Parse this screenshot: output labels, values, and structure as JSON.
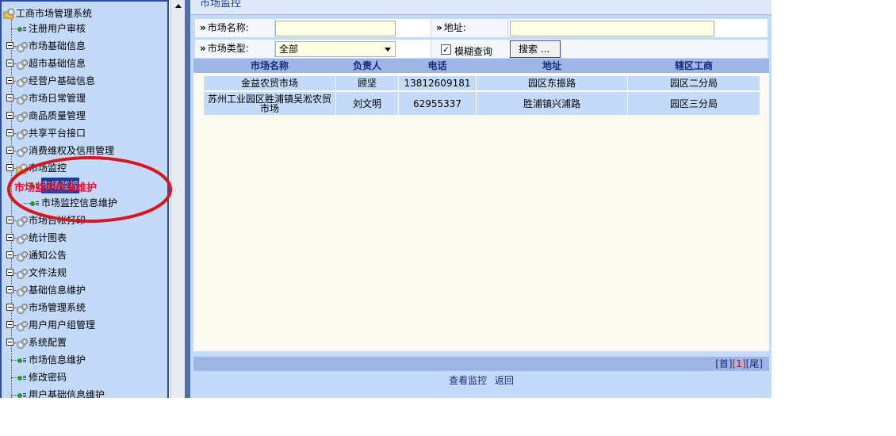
{
  "tree": {
    "root": "工商市场管理系统",
    "items": [
      {
        "label": "注册用户审核",
        "type": "leaf"
      },
      {
        "label": "市场基础信息",
        "type": "folder"
      },
      {
        "label": "超市基础信息",
        "type": "folder"
      },
      {
        "label": "经营户基础信息",
        "type": "folder"
      },
      {
        "label": "市场日常管理",
        "type": "folder"
      },
      {
        "label": "商品质量管理",
        "type": "folder"
      },
      {
        "label": "共享平台接口",
        "type": "folder"
      },
      {
        "label": "消费维权及信用管理",
        "type": "folder"
      },
      {
        "label": "市场监控",
        "type": "open-folder"
      },
      {
        "label": "市场监控",
        "type": "child"
      },
      {
        "label": "市场监控信息维护",
        "type": "child"
      },
      {
        "label": "市场台帐打印",
        "type": "folder"
      },
      {
        "label": "统计图表",
        "type": "folder"
      },
      {
        "label": "通知公告",
        "type": "folder"
      },
      {
        "label": "文件法规",
        "type": "folder"
      },
      {
        "label": "基础信息维护",
        "type": "folder"
      },
      {
        "label": "市场管理系统",
        "type": "folder"
      },
      {
        "label": "用户用户组管理",
        "type": "folder"
      },
      {
        "label": "系统配置",
        "type": "folder"
      },
      {
        "label": "市场信息维护",
        "type": "leaf"
      },
      {
        "label": "修改密码",
        "type": "leaf"
      },
      {
        "label": "用户基础信息维护",
        "type": "leaf"
      }
    ]
  },
  "annotation": {
    "text": "市场监控信息维护",
    "color": "#e8112d"
  },
  "page": {
    "title": "市场监控"
  },
  "form": {
    "market_name_label": "市场名称:",
    "market_name_value": "",
    "address_label": "地址:",
    "address_value": "",
    "market_type_label": "市场类型:",
    "market_type_value": "全部",
    "fuzzy_label": "模糊查询",
    "fuzzy_checked": true,
    "search_label": "搜索 ...",
    "raquo": "»"
  },
  "grid": {
    "columns": [
      "市场名称",
      "负责人",
      "电话",
      "地址",
      "辖区工商"
    ],
    "rows": [
      [
        "金益农贸市场",
        "顾坚",
        "13812609181",
        "园区东振路",
        "园区二分局"
      ],
      [
        "苏州工业园区胜浦镇吴淞农贸市场",
        "刘文明",
        "62955337",
        "胜浦镇兴浦路",
        "园区三分局"
      ]
    ]
  },
  "pager": {
    "first": "[首]",
    "current": "[1]",
    "last": "[尾]"
  },
  "actions": {
    "view": "查看监控",
    "back": "返回"
  },
  "colors": {
    "panel": "#c3daf9",
    "header": "#9db6e4",
    "accent": "#1a3f8c",
    "annotation": "#e8112d"
  }
}
